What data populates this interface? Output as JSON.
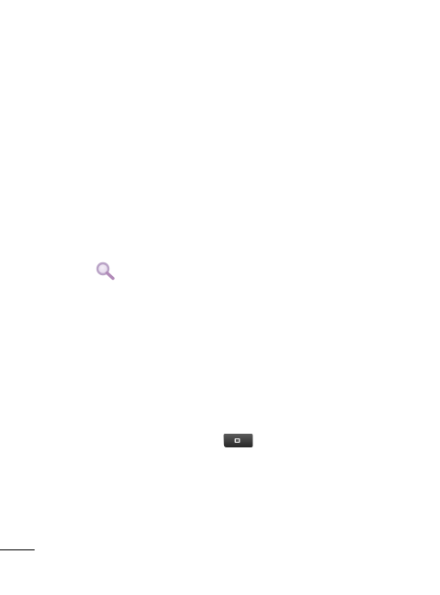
{
  "icons": {
    "search": "search-icon",
    "key": "phone-key-icon"
  },
  "colors": {
    "search_icon_ring": "#b9a3c6",
    "search_icon_handle": "#b18ab8",
    "key_dark": "#303030",
    "key_light": "#6a6a6a",
    "rule": "#000000"
  }
}
